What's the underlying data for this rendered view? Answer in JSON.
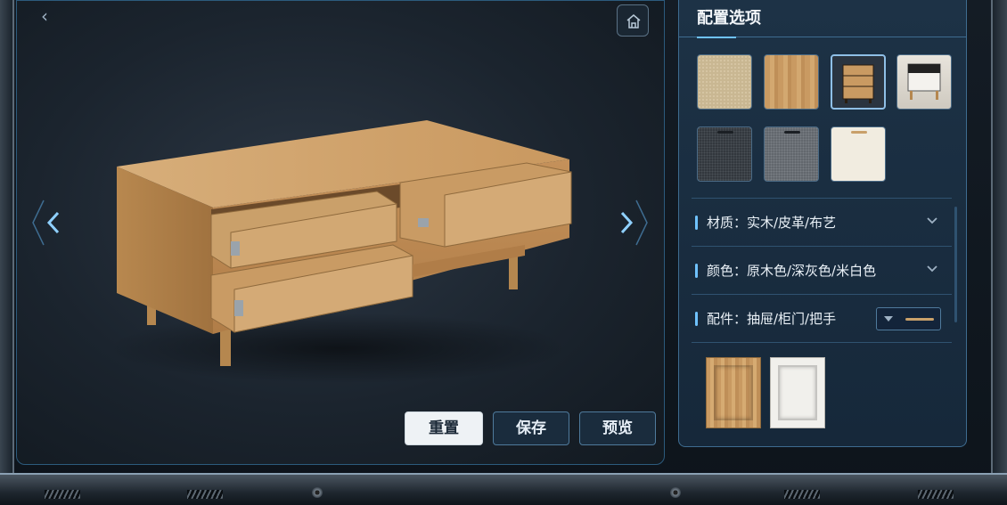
{
  "panel": {
    "title": "配置选项",
    "material_row": {
      "label": "材质：实木/皮革/布艺"
    },
    "color_row": {
      "label": "颜色：原木色/深灰色/米白色"
    },
    "accessory_row": {
      "label": "配件：抽屉/柜门/把手"
    }
  },
  "actions": {
    "reset": "重置",
    "save": "保存",
    "preview": "预览"
  },
  "colors": {
    "accent": "#6fc2ff",
    "panel_bg": "#1d3246",
    "wood": "#c99a62"
  }
}
